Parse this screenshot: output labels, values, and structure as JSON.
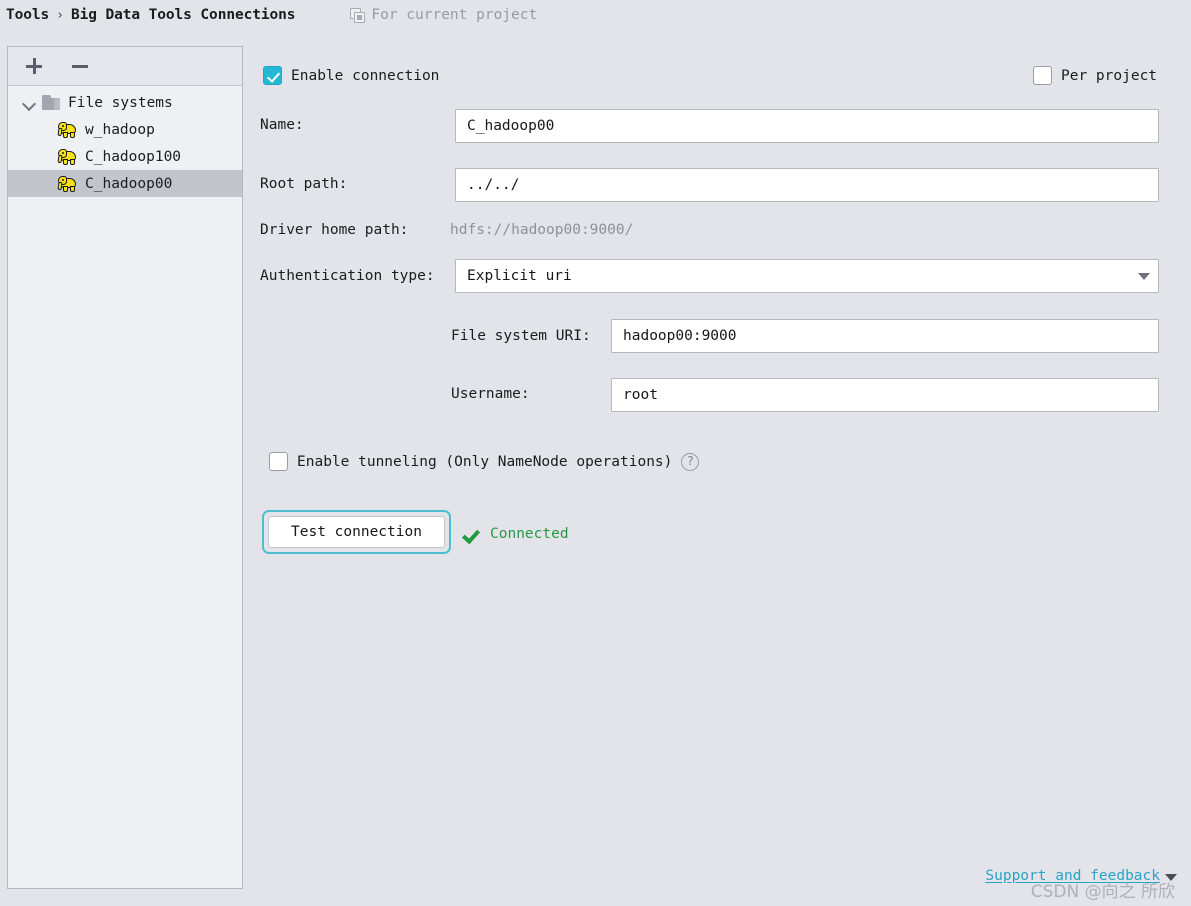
{
  "breadcrumb": {
    "root": "Tools",
    "separator": "›",
    "current": "Big Data Tools Connections",
    "scope_label": "For current project",
    "scope_icon": "modules-icon"
  },
  "sidebar": {
    "toolbar": {
      "add_label": "+",
      "remove_label": "−"
    },
    "tree": [
      {
        "label": "File systems",
        "type": "group",
        "icon": "folder-icon",
        "expanded": true,
        "selected": false
      },
      {
        "label": "w_hadoop",
        "type": "connection",
        "icon": "hadoop-elephant-icon",
        "selected": false
      },
      {
        "label": "C_hadoop100",
        "type": "connection",
        "icon": "hadoop-elephant-icon",
        "selected": false
      },
      {
        "label": "C_hadoop00",
        "type": "connection",
        "icon": "hadoop-elephant-icon",
        "selected": true
      }
    ]
  },
  "form": {
    "enable_connection": {
      "label": "Enable connection",
      "checked": true
    },
    "per_project": {
      "label": "Per project",
      "checked": false
    },
    "name": {
      "label": "Name:",
      "value": "C_hadoop00",
      "placeholder": ""
    },
    "root_path": {
      "label": "Root path:",
      "value": "../../",
      "placeholder": ""
    },
    "driver_home_path": {
      "label": "Driver home path:",
      "value": "hdfs://hadoop00:9000/"
    },
    "authentication_type": {
      "label": "Authentication type:",
      "value": "Explicit uri",
      "options": [
        "Explicit uri"
      ]
    },
    "file_system_uri": {
      "label": "File system URI:",
      "value": "hadoop00:9000",
      "placeholder": ""
    },
    "username": {
      "label": "Username:",
      "value": "root",
      "placeholder": ""
    },
    "enable_tunneling": {
      "label": "Enable tunneling (Only NameNode operations)",
      "checked": false,
      "help_glyph": "?"
    },
    "test_connection_button": "Test connection",
    "connection_status": {
      "text": "Connected",
      "icon": "check-icon",
      "color": "#239a41"
    }
  },
  "footer": {
    "support_link": "Support and feedback",
    "watermark": "CSDN @向之 所欣"
  },
  "colors": {
    "background": "#e3e4e9",
    "panel": "#eef0f3",
    "selection": "#c3c5cc",
    "accent_checkbox": "#25b8d4",
    "focus_ring": "#4fbcd4",
    "success": "#239a41",
    "link": "#2aa3c4",
    "hadoop_yellow": "#f5e317"
  }
}
